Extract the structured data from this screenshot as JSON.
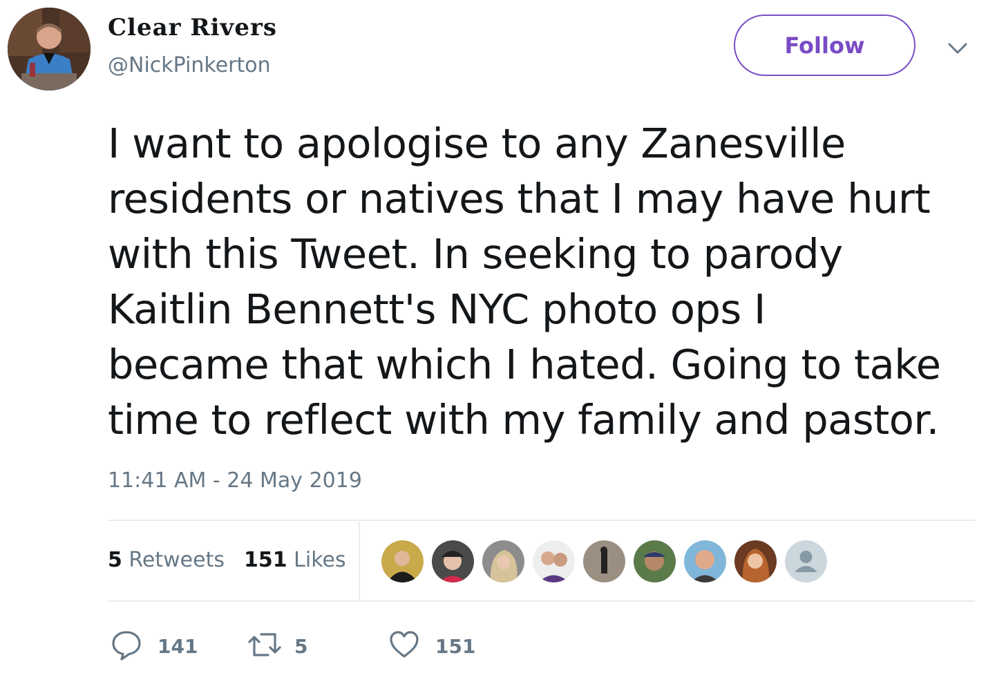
{
  "author": {
    "display_name": "Clear Rivers",
    "handle": "@NickPinkerton"
  },
  "follow_label": "Follow",
  "tweet": {
    "text": "I want to apologise to any Zanesville\nresidents or natives that I may have hurt\nwith this Tweet. In seeking to parody\nKaitlin Bennett's NYC photo ops I\nbecame that which I hated. Going to take\ntime to reflect with my family and pastor.",
    "timestamp": "11:41 AM - 24 May 2019"
  },
  "stats": {
    "retweets_count": "5",
    "retweets_label": "Retweets",
    "likes_count": "151",
    "likes_label": "Likes"
  },
  "actions": {
    "reply_count": "141",
    "retweet_count": "5",
    "like_count": "151"
  },
  "colors": {
    "accent": "#794bc4",
    "secondary_text": "#657786",
    "divider": "#e6ecf0"
  },
  "icons": [
    "chevron-down-icon",
    "reply-icon",
    "retweet-icon",
    "heart-icon"
  ]
}
